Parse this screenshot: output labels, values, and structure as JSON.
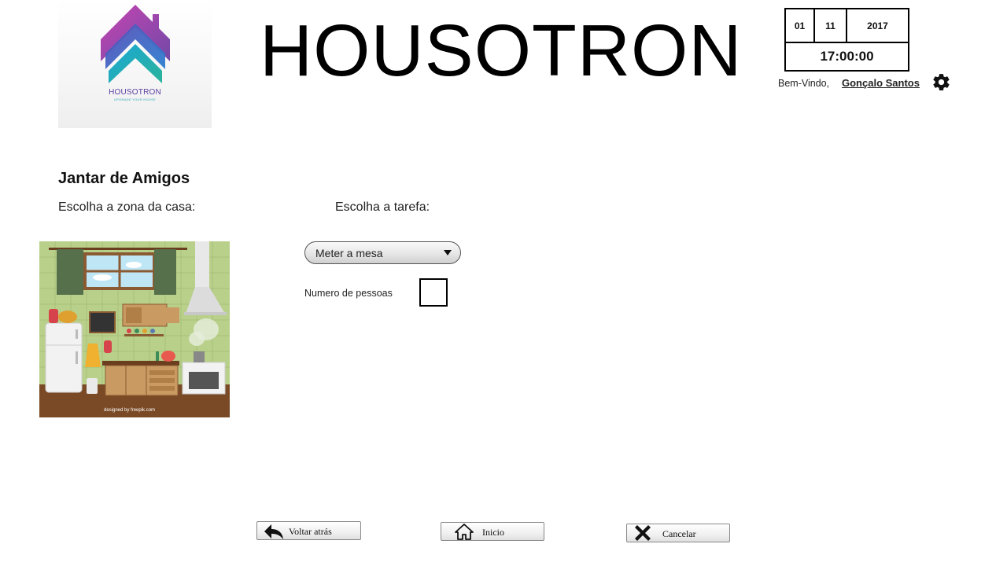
{
  "logo": {
    "name": "HOUSOTRON",
    "tagline": "UPGRADE YOUR HOUSE"
  },
  "header": {
    "title": "HOUSOTRON",
    "date": {
      "day": "01",
      "month": "11",
      "year": "2017"
    },
    "time": "17:00:00",
    "welcome": "Bem-Vindo,",
    "user": "Gonçalo Santos",
    "settings_icon": "gear-icon"
  },
  "main": {
    "title": "Jantar de Amigos",
    "zone_label": "Escolha a zona da casa:",
    "task_label": "Escolha a tarefa:",
    "zone_image": {
      "icon": "kitchen-illustration",
      "credit": "designed by freepik.com"
    },
    "task_select": {
      "value": "Meter a mesa"
    },
    "people_label": "Numero de pessoas",
    "people_value": ""
  },
  "footer": {
    "back": {
      "label": "Voltar atrás",
      "icon": "back-arrow-icon"
    },
    "home": {
      "label": "Inicio",
      "icon": "home-icon"
    },
    "cancel": {
      "label": "Cancelar",
      "icon": "close-icon"
    }
  },
  "colors": {
    "logo_purple": "#6b3fa0",
    "logo_magenta": "#c03bb0",
    "logo_teal": "#1ea9c4",
    "logo_green": "#3bb38a"
  }
}
